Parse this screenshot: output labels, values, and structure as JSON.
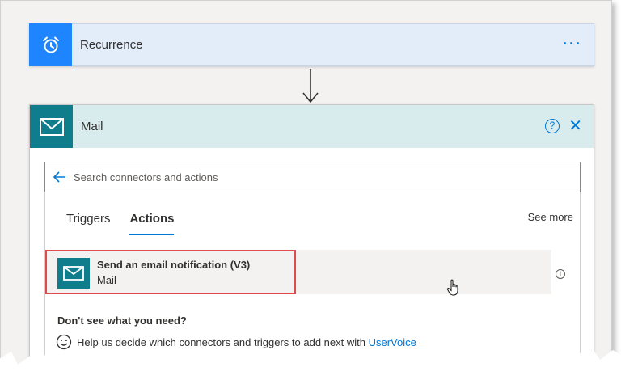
{
  "recurrence": {
    "title": "Recurrence",
    "more_label": "···",
    "icon": "alarm-clock-icon",
    "accent": "#1f85ff"
  },
  "mail": {
    "title": "Mail",
    "help_label": "?",
    "close_label": "✕",
    "icon": "envelope-icon",
    "accent": "#0f7d8c",
    "search": {
      "placeholder": "Search connectors and actions"
    },
    "tabs": [
      {
        "label": "Triggers",
        "active": false
      },
      {
        "label": "Actions",
        "active": true
      }
    ],
    "see_more": "See more",
    "action": {
      "title": "Send an email notification (V3)",
      "subtitle": "Mail",
      "info_label": "i"
    },
    "footer": {
      "heading": "Don't see what you need?",
      "help_text": "Help us decide which connectors and triggers to add next with ",
      "link": "UserVoice"
    }
  }
}
